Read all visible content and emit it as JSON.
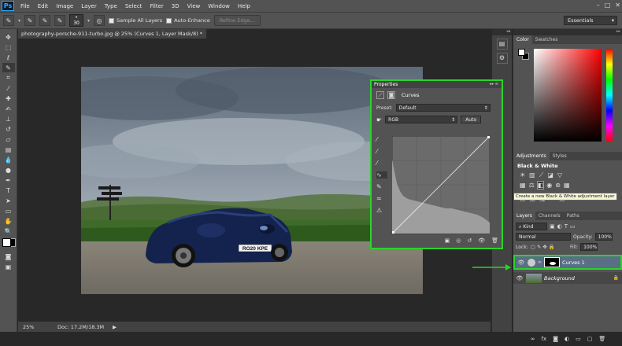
{
  "app": {
    "logo": "Ps"
  },
  "menu": [
    "File",
    "Edit",
    "Image",
    "Layer",
    "Type",
    "Select",
    "Filter",
    "3D",
    "View",
    "Window",
    "Help"
  ],
  "options": {
    "brush_size": "30",
    "sample_all_layers": "Sample All Layers",
    "auto_enhance": "Auto-Enhance",
    "refine_edge": "Refine Edge...",
    "workspace": "Essentials"
  },
  "document": {
    "tab_title": "photography-porsche-911-turbo.jpg @ 25% (Curves 1, Layer Mask/8) *",
    "zoom": "25%",
    "doc_size": "Doc: 17.2M/18.3M",
    "license_plate": "RO20 KPE"
  },
  "color_panel": {
    "tabs": [
      "Color",
      "Swatches"
    ]
  },
  "adjustments_panel": {
    "tabs": [
      "Adjustments",
      "Styles"
    ],
    "heading": "Black & White",
    "tooltip": "Create a new Black & White adjustment layer"
  },
  "layers_panel": {
    "tabs": [
      "Layers",
      "Channels",
      "Paths"
    ],
    "kind": "Kind",
    "blend_mode": "Normal",
    "opacity_label": "Opacity:",
    "opacity_value": "100%",
    "lock_label": "Lock:",
    "fill_label": "Fill:",
    "fill_value": "100%",
    "layers": [
      {
        "name": "Curves 1"
      },
      {
        "name": "Background"
      }
    ]
  },
  "properties_panel": {
    "title": "Properties",
    "type_label": "Curves",
    "preset_label": "Preset:",
    "preset_value": "Default",
    "channel_value": "RGB",
    "auto_button": "Auto"
  },
  "colors": {
    "highlight": "#2bd42b",
    "chrome": "#535353",
    "canvas_bg": "#282828"
  }
}
